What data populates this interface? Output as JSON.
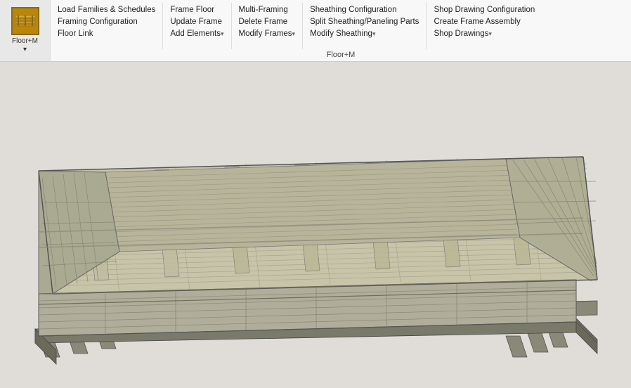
{
  "app": {
    "label_line1": "Floor+M",
    "label_line2": "▾"
  },
  "ribbon": {
    "tab_label": "Floor+M",
    "sections": [
      {
        "id": "section1",
        "items": [
          {
            "id": "load-families",
            "label": "Load Families & Schedules",
            "has_arrow": false
          },
          {
            "id": "framing-config",
            "label": "Framing Configuration",
            "has_arrow": false
          },
          {
            "id": "floor-link",
            "label": "Floor Link",
            "has_arrow": false
          }
        ]
      },
      {
        "id": "section2",
        "items": [
          {
            "id": "frame-floor",
            "label": "Frame Floor",
            "has_arrow": false
          },
          {
            "id": "update-frame",
            "label": "Update Frame",
            "has_arrow": false
          },
          {
            "id": "add-elements",
            "label": "Add Elements",
            "has_arrow": true
          }
        ]
      },
      {
        "id": "section3",
        "items": [
          {
            "id": "multi-framing",
            "label": "Multi-Framing",
            "has_arrow": false
          },
          {
            "id": "delete-frame",
            "label": "Delete Frame",
            "has_arrow": false
          },
          {
            "id": "modify-frames",
            "label": "Modify Frames",
            "has_arrow": true
          }
        ]
      },
      {
        "id": "section4",
        "items": [
          {
            "id": "sheathing-config",
            "label": "Sheathing Configuration",
            "has_arrow": false
          },
          {
            "id": "split-sheathing",
            "label": "Split Sheathing/Paneling Parts",
            "has_arrow": false
          },
          {
            "id": "modify-sheathing",
            "label": "Modify Sheathing",
            "has_arrow": true
          }
        ]
      },
      {
        "id": "section5",
        "items": [
          {
            "id": "shop-drawing-config",
            "label": "Shop Drawing Configuration",
            "has_arrow": false
          },
          {
            "id": "create-frame-assembly",
            "label": "Create Frame Assembly",
            "has_arrow": false
          },
          {
            "id": "shop-drawings",
            "label": "Shop Drawings",
            "has_arrow": true
          }
        ]
      }
    ]
  }
}
